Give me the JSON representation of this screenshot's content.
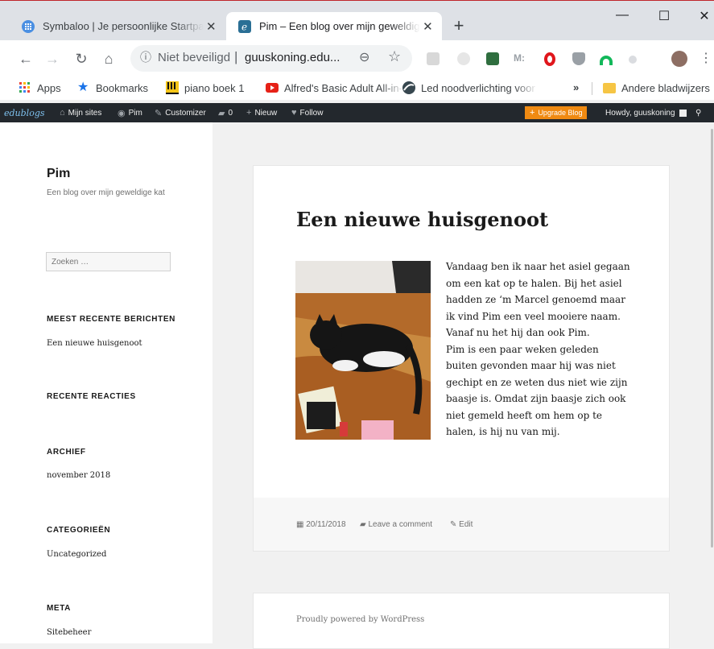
{
  "browser": {
    "tabs": [
      {
        "title": "Symbaloo | Je persoonlijke Startpagina",
        "favicon": "symbaloo-icon",
        "active": false
      },
      {
        "title": "Pim – Een blog over mijn geweldige kat",
        "favicon": "edublogs-icon",
        "active": true
      }
    ],
    "new_tab_label": "+",
    "window_controls": {
      "minimize": "—",
      "maximize": "☐",
      "close": "✕"
    },
    "omnibox": {
      "security_label": "Niet beveiligd",
      "url": "guuskoning.edu..."
    },
    "bookmarks": [
      {
        "label": "Apps",
        "icon": "apps-grid-icon"
      },
      {
        "label": "Bookmarks",
        "icon": "star-icon"
      },
      {
        "label": "piano boek 1",
        "icon": "piano-icon"
      },
      {
        "label": "Alfred's Basic Adult All-in-One",
        "icon": "youtube-icon"
      },
      {
        "label": "Led noodverlichting voor",
        "icon": "globe-icon"
      }
    ],
    "bookmarks_overflow": "»",
    "other_bookmarks": "Andere bladwijzers"
  },
  "adminbar": {
    "logo": "edublogs",
    "items": [
      "Mijn sites",
      "Pim",
      "Customizer",
      "0",
      "Nieuw",
      "Follow"
    ],
    "upgrade": "Upgrade Blog",
    "howdy": "Howdy, guuskoning"
  },
  "sidebar": {
    "site_title": "Pim",
    "site_description": "Een blog over mijn geweldige kat",
    "search_placeholder": "Zoeken …",
    "widgets": [
      {
        "title": "MEEST RECENTE BERICHTEN",
        "items": [
          "Een nieuwe huisgenoot"
        ]
      },
      {
        "title": "RECENTE REACTIES",
        "items": []
      },
      {
        "title": "ARCHIEF",
        "items": [
          "november 2018"
        ]
      },
      {
        "title": "CATEGORIEËN",
        "items": [
          "Uncategorized"
        ]
      },
      {
        "title": "META",
        "items": [
          "Sitebeheer"
        ]
      }
    ]
  },
  "post": {
    "title": "Een nieuwe huisgenoot",
    "lines": [
      "Vandaag ben ik naar het asiel gegaan",
      "om een kat op te halen. Bij het asiel",
      "hadden ze ‘m Marcel genoemd maar",
      "ik vind Pim een veel mooiere naam.",
      "Vanaf nu het hij dan ook Pim.",
      "Pim is een paar weken geleden",
      "buiten gevonden maar hij was niet",
      "gechipt en ze weten dus niet wie zijn",
      "baasje is. Omdat zijn baasje zich ook",
      "niet gemeld heeft om hem op te",
      "halen, is hij nu van mij."
    ],
    "date": "20/11/2018",
    "comment_link": "Leave a comment",
    "edit_link": "Edit"
  },
  "footer": {
    "powered": "Proudly powered by WordPress"
  },
  "colors": {
    "adminbar": "#23282d",
    "upgrade": "#f08a12",
    "tab_strip": "#dee1e6"
  }
}
